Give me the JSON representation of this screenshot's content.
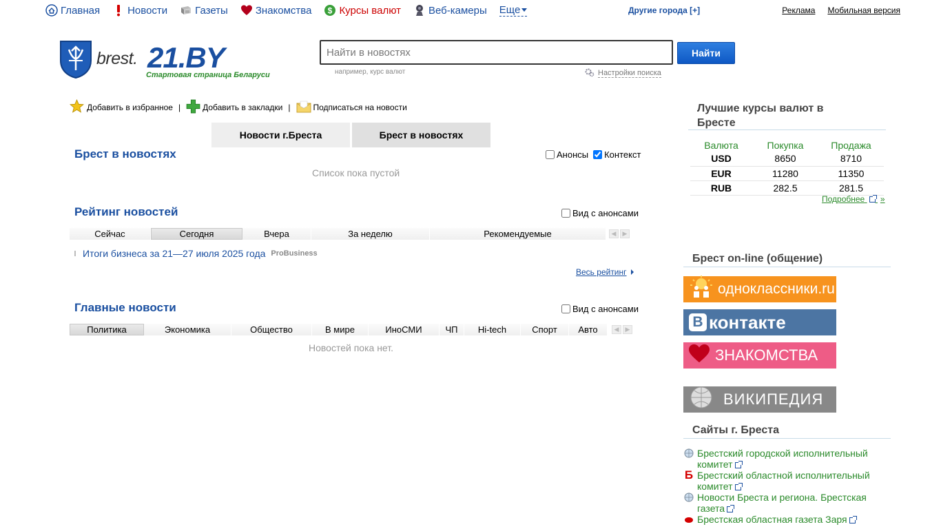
{
  "nav": {
    "items": [
      {
        "label": "Главная",
        "icon": "home-icon"
      },
      {
        "label": "Новости",
        "icon": "exclamation-icon"
      },
      {
        "label": "Газеты",
        "icon": "newspaper-icon"
      },
      {
        "label": "Знакомства",
        "icon": "heart-icon"
      },
      {
        "label": "Курсы валют",
        "icon": "dollar-icon"
      },
      {
        "label": "Веб-камеры",
        "icon": "webcam-icon"
      }
    ],
    "more_label": "Еще",
    "other_cities": "Другие города [+]",
    "ads": "Реклама",
    "mobile": "Мобильная версия"
  },
  "logo": {
    "brand_left": "brest.",
    "brand_main": "21.BY",
    "slogan": "Стартовая страница Беларуси"
  },
  "search": {
    "placeholder": "Найти в новостях",
    "button": "Найти",
    "example": "например, курс валют",
    "settings": "Настройки поиска"
  },
  "actions": {
    "favorites": "Добавить в избранное",
    "bookmarks": "Добавить в закладки",
    "subscribe": "Подписаться на новости",
    "separator": "|"
  },
  "tabs": [
    {
      "label": "Новости г.Бреста"
    },
    {
      "label": "Брест в новостях"
    }
  ],
  "brest_news": {
    "title": "Брест в новостях",
    "opt_announces": "Анонсы",
    "opt_context": "Контекст",
    "empty": "Список пока пустой"
  },
  "rating": {
    "title": "Рейтинг новостей",
    "opt_view": "Вид с анонсами",
    "filters": [
      "Сейчас",
      "Сегодня",
      "Вчера",
      "За неделю",
      "Рекомендуемые"
    ],
    "item_title": "Итоги бизнеса за 21—27 июля 2025 года",
    "item_source": "ProBusiness",
    "all_link": "Весь рейтинг"
  },
  "main_news": {
    "title": "Главные новости",
    "opt_view": "Вид с анонсами",
    "filters": [
      "Политика",
      "Экономика",
      "Общество",
      "В мире",
      "ИноСМИ",
      "ЧП",
      "Hi-tech",
      "Спорт",
      "Авто"
    ],
    "empty": "Новостей пока нет."
  },
  "rates": {
    "title": "Лучшие курсы валют в Бресте",
    "head": [
      "Валюта",
      "Покупка",
      "Продажа"
    ],
    "rows": [
      [
        "USD",
        "8650",
        "8710"
      ],
      [
        "EUR",
        "11280",
        "11350"
      ],
      [
        "RUB",
        "282.5",
        "281.5"
      ]
    ],
    "more": "Подробнее"
  },
  "online": {
    "title": "Брест on-line (общение)",
    "banners": [
      "одноклассники.ru",
      "контакте",
      "ЗНАКОМСТВА",
      "ВИКИПЕДИЯ"
    ]
  },
  "sites": {
    "title": "Сайты г. Бреста",
    "items": [
      {
        "line1": "Брестский городской исполнительный",
        "line2": "комитет"
      },
      {
        "line1": "Брестский областной исполнительный",
        "line2": "комитет"
      },
      {
        "line1": "Новости Бреста и региона. Брестская",
        "line2": "газета"
      },
      {
        "line1": "Брестская областная газета Заря",
        "line2": ""
      }
    ]
  },
  "colors": {
    "link_blue": "#1a4fa0",
    "green": "#2a8a2a",
    "red": "#cc0000",
    "button_blue": "#0e58c4"
  }
}
